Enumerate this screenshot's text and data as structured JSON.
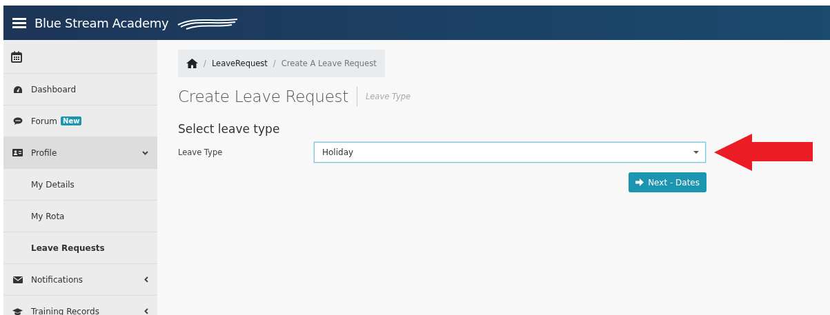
{
  "header": {
    "title": "Blue Stream Academy"
  },
  "sidebar": {
    "items": [
      {
        "label": "Dashboard",
        "kind": "item"
      },
      {
        "label": "Forum",
        "kind": "item",
        "badge": "New"
      },
      {
        "label": "Profile",
        "kind": "item",
        "expanded": true,
        "selected": true
      },
      {
        "label": "My Details",
        "kind": "subitem",
        "selected": false
      },
      {
        "label": "My Rota",
        "kind": "subitem",
        "selected": false
      },
      {
        "label": "Leave Requests",
        "kind": "subitem",
        "selected": true
      },
      {
        "label": "Notifications",
        "kind": "item",
        "expanded": false,
        "selected": false
      },
      {
        "label": "Training Records",
        "kind": "item",
        "expanded": false,
        "selected": false
      }
    ]
  },
  "breadcrumb": [
    {
      "kind": "separator",
      "text": "/"
    },
    {
      "kind": "link",
      "text": "LeaveRequest"
    },
    {
      "kind": "separator",
      "text": "/"
    },
    {
      "kind": "current",
      "text": "Create A Leave Request"
    }
  ],
  "page": {
    "title": "Create Leave Request",
    "subtitle": "Leave Type"
  },
  "form": {
    "heading": "Select leave type",
    "label": "Leave Type",
    "value": "Holiday",
    "button": "Next - Dates"
  }
}
